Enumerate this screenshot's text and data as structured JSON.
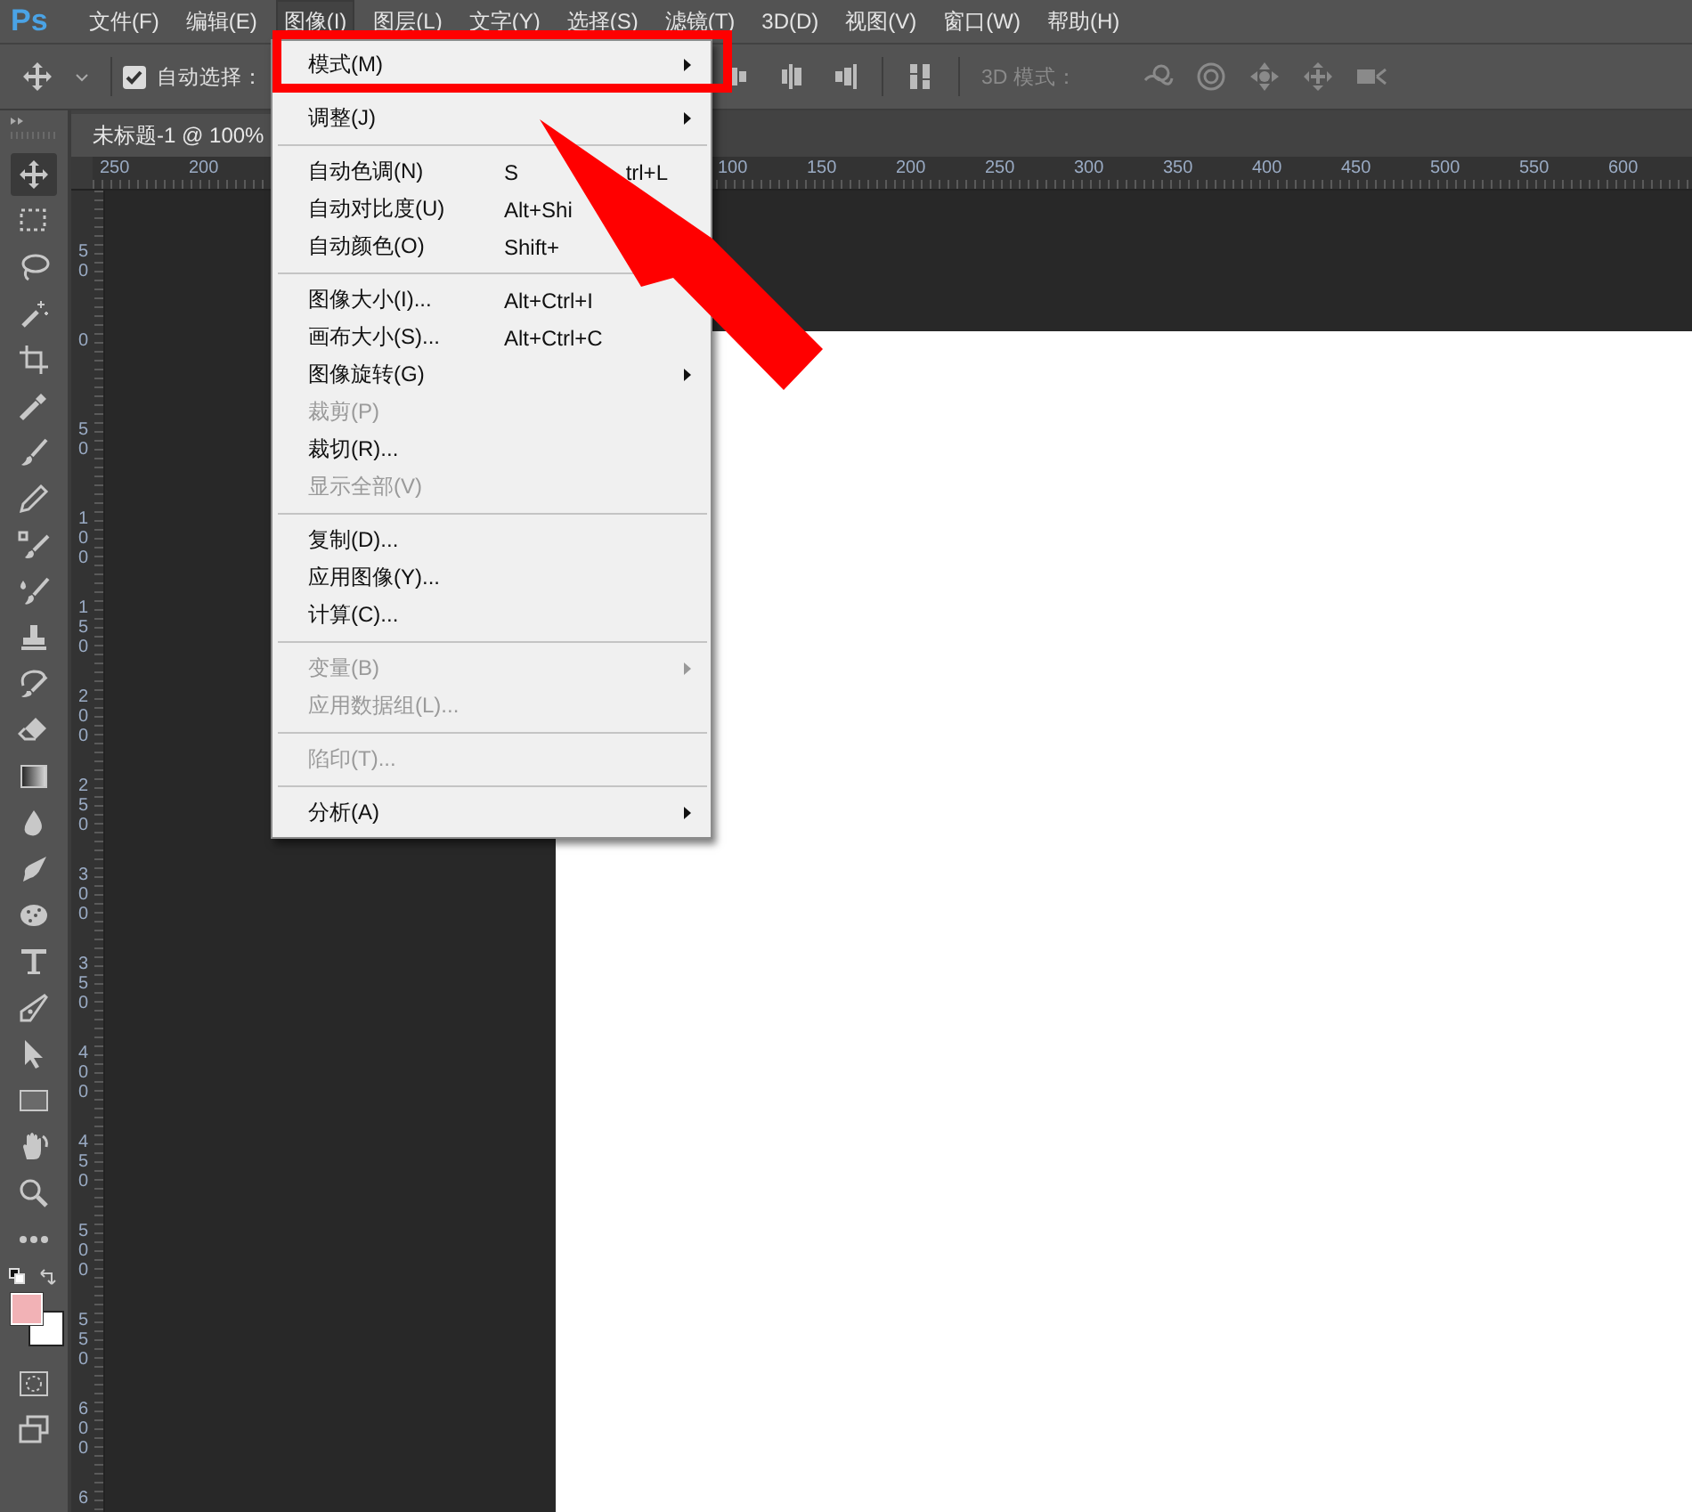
{
  "app_logo": "Ps",
  "menu_bar": [
    {
      "label": "文件(F)",
      "selected": false
    },
    {
      "label": "编辑(E)",
      "selected": false
    },
    {
      "label": "图像(I)",
      "selected": true
    },
    {
      "label": "图层(L)",
      "selected": false
    },
    {
      "label": "文字(Y)",
      "selected": false
    },
    {
      "label": "选择(S)",
      "selected": false
    },
    {
      "label": "滤镜(T)",
      "selected": false
    },
    {
      "label": "3D(D)",
      "selected": false
    },
    {
      "label": "视图(V)",
      "selected": false
    },
    {
      "label": "窗口(W)",
      "selected": false
    },
    {
      "label": "帮助(H)",
      "selected": false
    }
  ],
  "options_bar": {
    "auto_select": {
      "label": "自动选择：",
      "checked": true
    },
    "mode_3d_label": "3D 模式："
  },
  "document_tab": {
    "title": "未标题-1 @ 100%"
  },
  "top_ruler": {
    "left_labels": [
      "250",
      "200"
    ],
    "right_labels": [
      "100",
      "150",
      "200",
      "250",
      "300",
      "350",
      "400",
      "450",
      "500",
      "550",
      "600"
    ]
  },
  "left_ruler": [
    "50",
    "0",
    "50",
    "100",
    "150",
    "200",
    "250",
    "300",
    "350",
    "400",
    "450",
    "500",
    "550",
    "600",
    "6"
  ],
  "tools": [
    {
      "selected": true
    },
    {
      "selected": false
    },
    {
      "selected": false
    },
    {
      "selected": false
    },
    {
      "selected": false
    },
    {
      "selected": false
    },
    {
      "selected": false
    },
    {
      "selected": false
    },
    {
      "selected": false
    },
    {
      "selected": false
    },
    {
      "selected": false
    },
    {
      "selected": false
    },
    {
      "selected": false
    },
    {
      "selected": false
    },
    {
      "selected": false
    },
    {
      "selected": false
    },
    {
      "selected": false
    },
    {
      "selected": false
    },
    {
      "selected": false
    },
    {
      "selected": false
    },
    {
      "selected": false
    },
    {
      "selected": false
    },
    {
      "selected": false
    },
    {
      "selected": false
    }
  ],
  "image_menu": [
    {
      "kind": "item",
      "label": "模式(M)",
      "submenu": true,
      "disabled": false
    },
    {
      "kind": "separator"
    },
    {
      "kind": "item",
      "label": "调整(J)",
      "submenu": true,
      "disabled": false
    },
    {
      "kind": "separator"
    },
    {
      "kind": "item",
      "label": "自动色调(N)",
      "shortcut": [
        "S",
        "trl+L"
      ],
      "submenu": false,
      "disabled": false
    },
    {
      "kind": "item",
      "label": "自动对比度(U)",
      "shortcut": [
        "Alt+Shi"
      ],
      "submenu": false,
      "disabled": false
    },
    {
      "kind": "item",
      "label": "自动颜色(O)",
      "shortcut": [
        "Shift+"
      ],
      "submenu": false,
      "disabled": false
    },
    {
      "kind": "separator"
    },
    {
      "kind": "item",
      "label": "图像大小(I)...",
      "shortcut": [
        "Alt+Ctrl+I"
      ],
      "submenu": false,
      "disabled": false
    },
    {
      "kind": "item",
      "label": "画布大小(S)...",
      "shortcut": [
        "Alt+Ctrl+C"
      ],
      "submenu": false,
      "disabled": false
    },
    {
      "kind": "item",
      "label": "图像旋转(G)",
      "submenu": true,
      "disabled": false
    },
    {
      "kind": "item",
      "label": "裁剪(P)",
      "submenu": false,
      "disabled": true
    },
    {
      "kind": "item",
      "label": "裁切(R)...",
      "submenu": false,
      "disabled": false
    },
    {
      "kind": "item",
      "label": "显示全部(V)",
      "submenu": false,
      "disabled": true
    },
    {
      "kind": "separator"
    },
    {
      "kind": "item",
      "label": "复制(D)...",
      "submenu": false,
      "disabled": false
    },
    {
      "kind": "item",
      "label": "应用图像(Y)...",
      "submenu": false,
      "disabled": false
    },
    {
      "kind": "item",
      "label": "计算(C)...",
      "submenu": false,
      "disabled": false
    },
    {
      "kind": "separator"
    },
    {
      "kind": "item",
      "label": "变量(B)",
      "submenu": true,
      "disabled": true
    },
    {
      "kind": "item",
      "label": "应用数据组(L)...",
      "submenu": false,
      "disabled": true
    },
    {
      "kind": "separator"
    },
    {
      "kind": "item",
      "label": "陷印(T)...",
      "submenu": false,
      "disabled": true
    },
    {
      "kind": "separator"
    },
    {
      "kind": "item",
      "label": "分析(A)",
      "submenu": true,
      "disabled": false
    }
  ]
}
